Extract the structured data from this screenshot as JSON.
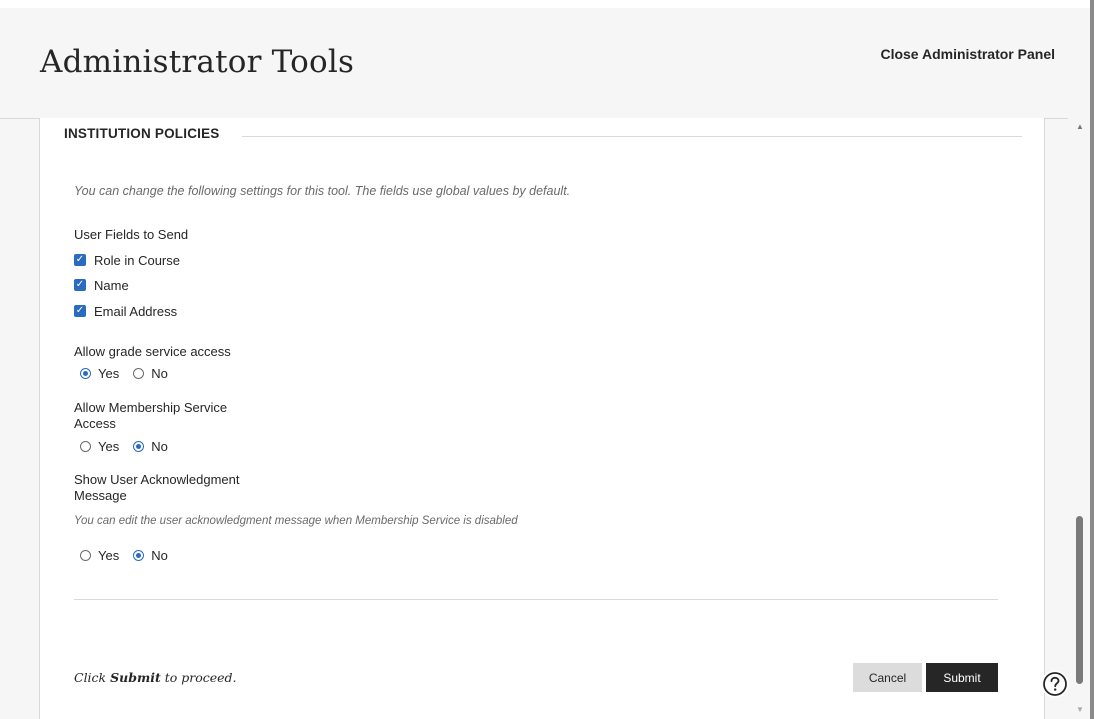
{
  "header": {
    "title": "Administrator Tools",
    "close_label": "Close Administrator Panel"
  },
  "section": {
    "legend": "INSTITUTION POLICIES",
    "intro": "You can change the following settings for this tool. The fields use global values by default."
  },
  "user_fields": {
    "label": "User Fields to Send",
    "options": [
      {
        "label": "Role in Course",
        "checked": true
      },
      {
        "label": "Name",
        "checked": true
      },
      {
        "label": "Email Address",
        "checked": true
      }
    ]
  },
  "grade_service": {
    "label": "Allow grade service access",
    "yes": "Yes",
    "no": "No",
    "selected": "Yes"
  },
  "membership_service": {
    "label_line1": "Allow Membership Service",
    "label_line2": "Access",
    "yes": "Yes",
    "no": "No",
    "selected": "No"
  },
  "acknowledgment": {
    "label_line1": "Show User Acknowledgment",
    "label_line2": "Message",
    "hint": "You can edit the user acknowledgment message when Membership Service is disabled",
    "yes": "Yes",
    "no": "No",
    "selected": "No"
  },
  "footer": {
    "hint_prefix": "Click ",
    "hint_bold": "Submit",
    "hint_suffix": " to proceed.",
    "cancel_label": "Cancel",
    "submit_label": "Submit"
  },
  "colors": {
    "accent": "#2a6bbf",
    "submit_bg": "#262626",
    "cancel_bg": "#dcdcdc"
  },
  "icons": {
    "help": "help-icon",
    "checkbox": "checkmark-icon"
  }
}
